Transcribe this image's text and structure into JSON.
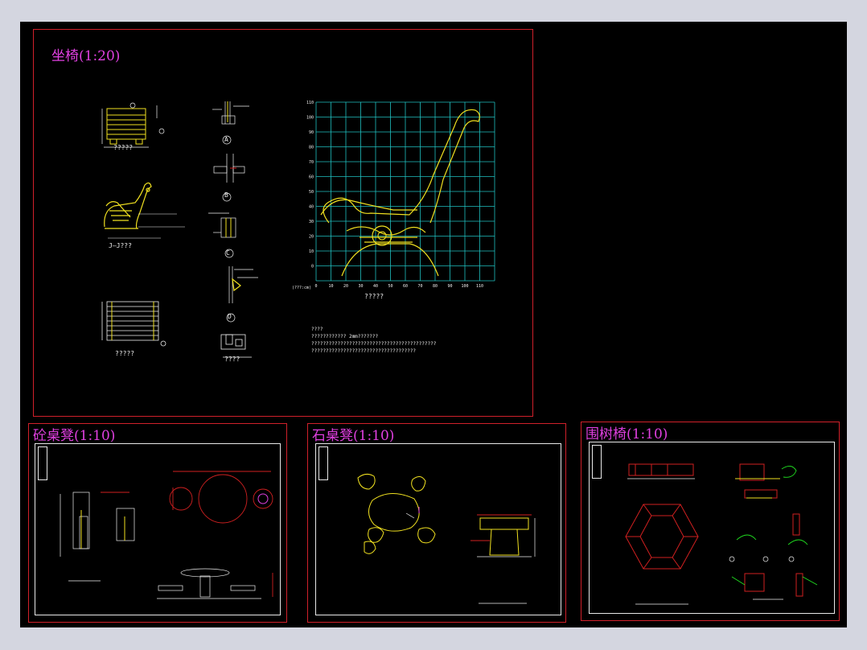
{
  "sheets": {
    "main": {
      "title": "坐椅(1:20)"
    },
    "concrete": {
      "title": "砼桌凳(1:10)"
    },
    "stone": {
      "title": "石桌凳(1:10)"
    },
    "tree": {
      "title": "围树椅(1:10)"
    }
  },
  "main_captions": {
    "front_view": "?????",
    "side_view": "J—J???",
    "top_view": "?????",
    "grid_view": "?????",
    "detail_e": "????"
  },
  "detail_markers": [
    "A",
    "B",
    "C",
    "D"
  ],
  "grid_axis": {
    "x_ticks": [
      "0",
      "10",
      "20",
      "30",
      "40",
      "50",
      "60",
      "70",
      "80",
      "90",
      "100",
      "110"
    ],
    "y_ticks": [
      "110",
      "100",
      "90",
      "80",
      "70",
      "60",
      "50",
      "40",
      "30",
      "20",
      "10",
      "0"
    ],
    "x_unit": "(???:cm)"
  },
  "notes": [
    "????",
    "????????????  2mm???????",
    "???????????????????????????????????????????",
    "????????????????????????????????????"
  ],
  "colors": {
    "sheet_border": "#d0202a",
    "title": "#e040e0",
    "grid": "#20c0c0",
    "bench": "#f0e020",
    "dimension": "#e02020",
    "leader": "#20e020"
  }
}
